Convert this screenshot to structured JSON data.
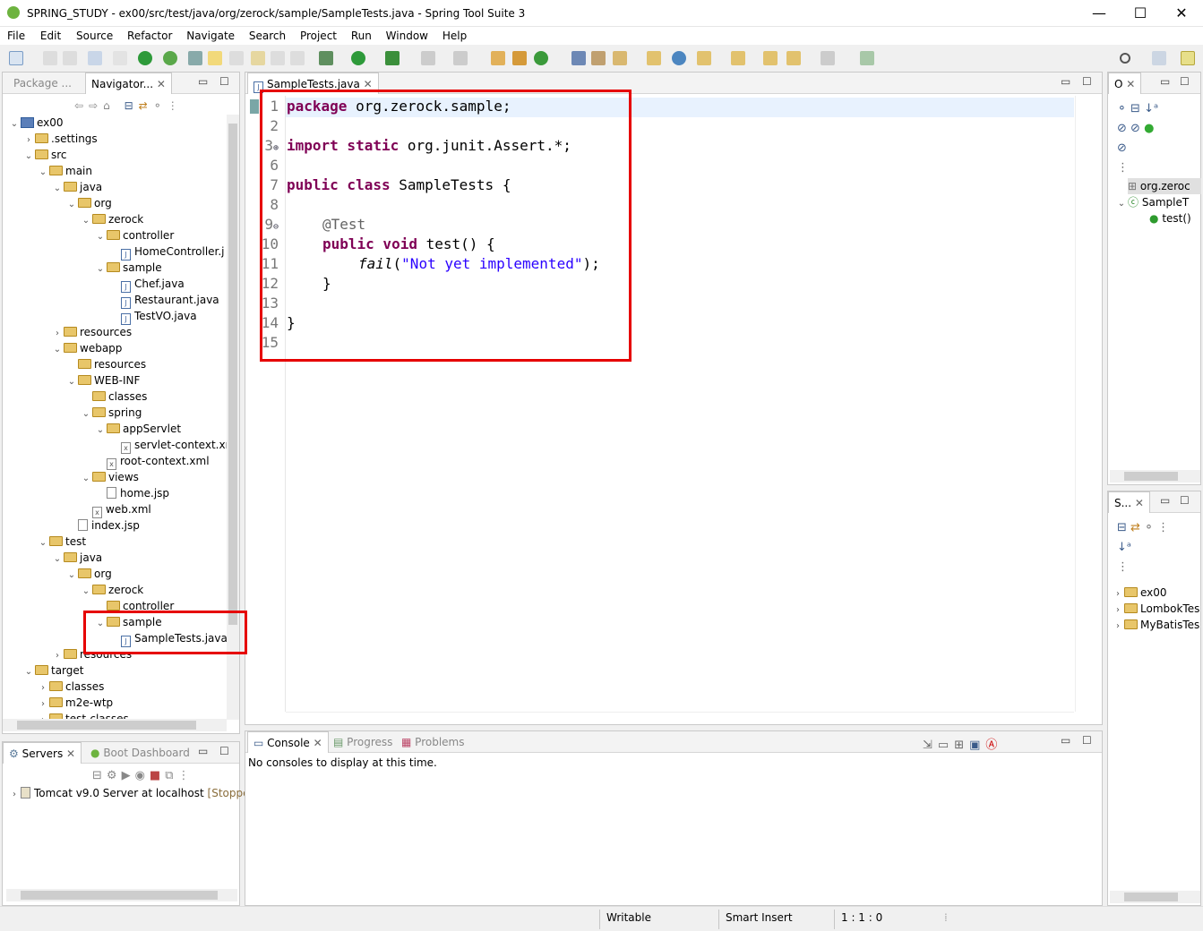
{
  "window": {
    "title": "SPRING_STUDY - ex00/src/test/java/org/zerock/sample/SampleTests.java - Spring Tool Suite 3",
    "min": "—",
    "max": "☐",
    "close": "✕"
  },
  "menu": [
    "File",
    "Edit",
    "Source",
    "Refactor",
    "Navigate",
    "Search",
    "Project",
    "Run",
    "Window",
    "Help"
  ],
  "left_panel": {
    "tabs": [
      "Package ...",
      "Navigator..."
    ],
    "tree": [
      {
        "label": "ex00",
        "indent": 0,
        "arrow": "v",
        "icon": "project"
      },
      {
        "label": ".settings",
        "indent": 1,
        "arrow": ">",
        "icon": "folder"
      },
      {
        "label": "src",
        "indent": 1,
        "arrow": "v",
        "icon": "folder"
      },
      {
        "label": "main",
        "indent": 2,
        "arrow": "v",
        "icon": "folder"
      },
      {
        "label": "java",
        "indent": 3,
        "arrow": "v",
        "icon": "folder"
      },
      {
        "label": "org",
        "indent": 4,
        "arrow": "v",
        "icon": "folder"
      },
      {
        "label": "zerock",
        "indent": 5,
        "arrow": "v",
        "icon": "folder"
      },
      {
        "label": "controller",
        "indent": 6,
        "arrow": "v",
        "icon": "folder"
      },
      {
        "label": "HomeController.j",
        "indent": 7,
        "arrow": "",
        "icon": "java"
      },
      {
        "label": "sample",
        "indent": 6,
        "arrow": "v",
        "icon": "folder"
      },
      {
        "label": "Chef.java",
        "indent": 7,
        "arrow": "",
        "icon": "java"
      },
      {
        "label": "Restaurant.java",
        "indent": 7,
        "arrow": "",
        "icon": "java"
      },
      {
        "label": "TestVO.java",
        "indent": 7,
        "arrow": "",
        "icon": "java"
      },
      {
        "label": "resources",
        "indent": 3,
        "arrow": ">",
        "icon": "folder"
      },
      {
        "label": "webapp",
        "indent": 3,
        "arrow": "v",
        "icon": "folder"
      },
      {
        "label": "resources",
        "indent": 4,
        "arrow": "",
        "icon": "folder"
      },
      {
        "label": "WEB-INF",
        "indent": 4,
        "arrow": "v",
        "icon": "folder"
      },
      {
        "label": "classes",
        "indent": 5,
        "arrow": "",
        "icon": "folder"
      },
      {
        "label": "spring",
        "indent": 5,
        "arrow": "v",
        "icon": "folder"
      },
      {
        "label": "appServlet",
        "indent": 6,
        "arrow": "v",
        "icon": "folder"
      },
      {
        "label": "servlet-context.xr",
        "indent": 7,
        "arrow": "",
        "icon": "xml"
      },
      {
        "label": "root-context.xml",
        "indent": 6,
        "arrow": "",
        "icon": "xml"
      },
      {
        "label": "views",
        "indent": 5,
        "arrow": "v",
        "icon": "folder"
      },
      {
        "label": "home.jsp",
        "indent": 6,
        "arrow": "",
        "icon": "file"
      },
      {
        "label": "web.xml",
        "indent": 5,
        "arrow": "",
        "icon": "xml"
      },
      {
        "label": "index.jsp",
        "indent": 4,
        "arrow": "",
        "icon": "file"
      },
      {
        "label": "test",
        "indent": 2,
        "arrow": "v",
        "icon": "folder"
      },
      {
        "label": "java",
        "indent": 3,
        "arrow": "v",
        "icon": "folder"
      },
      {
        "label": "org",
        "indent": 4,
        "arrow": "v",
        "icon": "folder"
      },
      {
        "label": "zerock",
        "indent": 5,
        "arrow": "v",
        "icon": "folder"
      },
      {
        "label": "controller",
        "indent": 6,
        "arrow": "",
        "icon": "folder"
      },
      {
        "label": "sample",
        "indent": 6,
        "arrow": "v",
        "icon": "folder"
      },
      {
        "label": "SampleTests.java",
        "indent": 7,
        "arrow": "",
        "icon": "java"
      },
      {
        "label": "resources",
        "indent": 3,
        "arrow": ">",
        "icon": "folder"
      },
      {
        "label": "target",
        "indent": 1,
        "arrow": "v",
        "icon": "folder"
      },
      {
        "label": "classes",
        "indent": 2,
        "arrow": ">",
        "icon": "folder"
      },
      {
        "label": "m2e-wtp",
        "indent": 2,
        "arrow": ">",
        "icon": "folder"
      },
      {
        "label": "test-classes",
        "indent": 2,
        "arrow": ">",
        "icon": "folder"
      }
    ]
  },
  "servers_panel": {
    "tabs": [
      "Servers",
      "Boot Dashboard"
    ],
    "server": "Tomcat v9.0 Server at localhost",
    "state": "[Stoppe"
  },
  "editor": {
    "tab": "SampleTests.java",
    "line_numbers": [
      "1",
      "2",
      "3",
      "6",
      "7",
      "8",
      "9",
      "10",
      "11",
      "12",
      "13",
      "14",
      "15"
    ],
    "code": {
      "l1_kw": "package",
      "l1_rest": " org.zerock.sample;",
      "l3_kw": "import static",
      "l3_rest": " org.junit.Assert.*;",
      "l7_kw": "public class",
      "l7_rest": " SampleTests {",
      "l9_ann": "@Test",
      "l10_kw": "public void",
      "l10_rest": " test() {",
      "l11_fn": "fail",
      "l11_open": "(",
      "l11_str": "\"Not yet implemented\"",
      "l11_close": ");",
      "l12": "}",
      "l14": "}"
    }
  },
  "console": {
    "tabs": [
      "Console",
      "Progress",
      "Problems"
    ],
    "message": "No consoles to display at this time."
  },
  "outline": {
    "tab": "O",
    "items": [
      "org.zeroc",
      "SampleT",
      "test()"
    ]
  },
  "explorer2": {
    "tab": "S...",
    "items": [
      "ex00",
      "LombokTes",
      "MyBatisTes"
    ]
  },
  "status": {
    "writable": "Writable",
    "insert": "Smart Insert",
    "position": "1 : 1 : 0"
  },
  "colors": {
    "keyword": "#7f0055",
    "string": "#2a00ff",
    "annotation": "#646464",
    "highlight_box": "#e60000"
  }
}
